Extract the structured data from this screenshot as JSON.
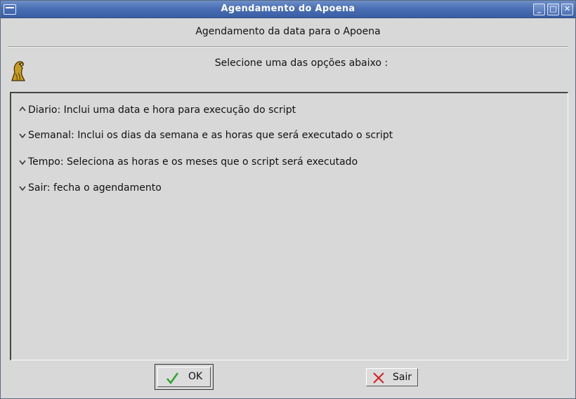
{
  "window": {
    "title": "Agendamento do Apoena"
  },
  "titlebar_buttons": {
    "minimize": "_",
    "maximize": "□",
    "close": "✕"
  },
  "header": {
    "label": "Agendamento da data para o Apoena"
  },
  "prompt": {
    "text": "Selecione uma das opções abaixo :"
  },
  "options": [
    {
      "label": "Diario: Inclui uma data e hora para execução do script",
      "selected": true
    },
    {
      "label": "Semanal: Inclui os dias da semana e as horas que será executado o script",
      "selected": false
    },
    {
      "label": "Tempo: Seleciona as horas e os meses que o script será executado",
      "selected": false
    },
    {
      "label": "Sair: fecha o agendamento",
      "selected": false
    }
  ],
  "buttons": {
    "ok": "OK",
    "sair": "Sair"
  },
  "colors": {
    "titlebar": "#4a6fb5",
    "ok_check": "#2aa52a",
    "sair_x": "#d42020",
    "eagle": "#c89a20"
  }
}
